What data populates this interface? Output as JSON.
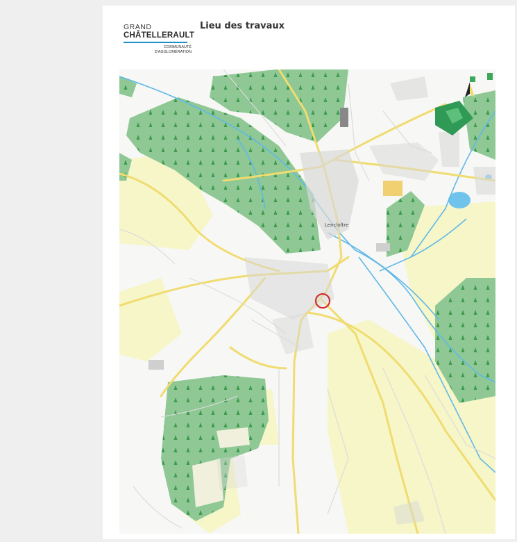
{
  "logo": {
    "line1": "GRAND",
    "line2": "CHÂTELLERAULT",
    "line3": "COMMUNAUTÉ",
    "line4": "D'AGGLOMÉRATION"
  },
  "title": "Lieu des travaux",
  "map": {
    "town_label": "Lencloître",
    "colors": {
      "forest": "#8fc894",
      "field": "#f6f6c8",
      "road": "#f0dc70",
      "water": "#60b8e8",
      "marker": "#d03030"
    },
    "icons": [
      "north-arrow-icon",
      "location-marker-icon",
      "tree-icon"
    ]
  }
}
